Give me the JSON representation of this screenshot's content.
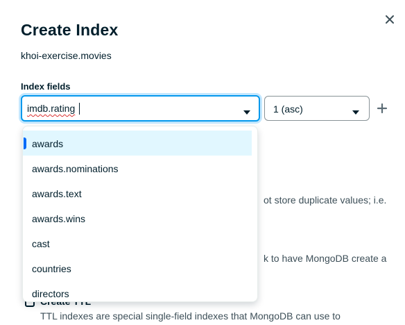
{
  "modal": {
    "title": "Create Index",
    "namespace": "khoi-exercise.movies",
    "index_fields_label": "Index fields",
    "field_input_value": "imdb.rating",
    "type_select_value": "1 (asc)"
  },
  "dropdown": {
    "options": [
      {
        "label": "awards",
        "active": true
      },
      {
        "label": "awards.nominations",
        "active": false
      },
      {
        "label": "awards.text",
        "active": false
      },
      {
        "label": "awards.wins",
        "active": false
      },
      {
        "label": "cast",
        "active": false
      },
      {
        "label": "countries",
        "active": false
      },
      {
        "label": "directors",
        "active": false
      }
    ]
  },
  "background": {
    "unique_desc_fragment": "ot store duplicate values; i.e.",
    "wildcard_desc_fragment": "k to have MongoDB create a",
    "ttl_label": "Create TTL",
    "ttl_desc": "TTL indexes are special single-field indexes that MongoDB can use to"
  },
  "icons": {
    "close": "close-icon",
    "chevron": "chevron-down-icon",
    "add": "plus-icon"
  },
  "colors": {
    "focus_border": "#0498ec",
    "active_option_bg": "#e1f7ff",
    "active_bar": "#016bf8",
    "text": "#001e2b"
  }
}
